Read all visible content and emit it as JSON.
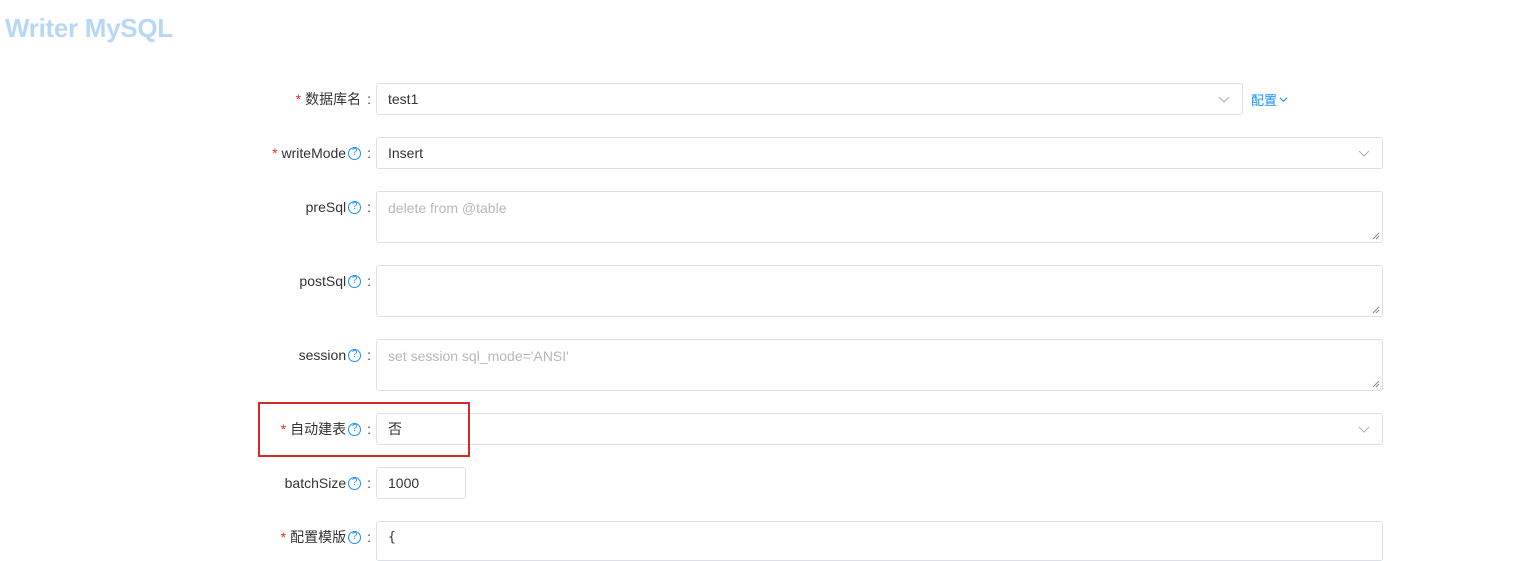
{
  "page": {
    "title": "Writer MySQL"
  },
  "form": {
    "database": {
      "label": "数据库名",
      "required_mark": "*",
      "value": "test1",
      "config_link": "配置"
    },
    "write_mode": {
      "label": "writeMode",
      "required_mark": "*",
      "value": "Insert"
    },
    "pre_sql": {
      "label": "preSql",
      "placeholder": "delete from @table",
      "value": ""
    },
    "post_sql": {
      "label": "postSql",
      "placeholder": "",
      "value": ""
    },
    "session": {
      "label": "session",
      "placeholder": "set session sql_mode='ANSI'",
      "value": ""
    },
    "auto_create_table": {
      "label": "自动建表",
      "required_mark": "*",
      "value": "否"
    },
    "batch_size": {
      "label": "batchSize",
      "value": "1000"
    },
    "config_template": {
      "label": "配置模版",
      "required_mark": "*",
      "value": "{"
    },
    "colon": ":",
    "help_glyph": "?"
  },
  "colors": {
    "title": "#b8d7f6",
    "required": "#e0302b",
    "link": "#1890ff",
    "highlight_border": "#d42a2a",
    "border": "#dcdfe6"
  }
}
